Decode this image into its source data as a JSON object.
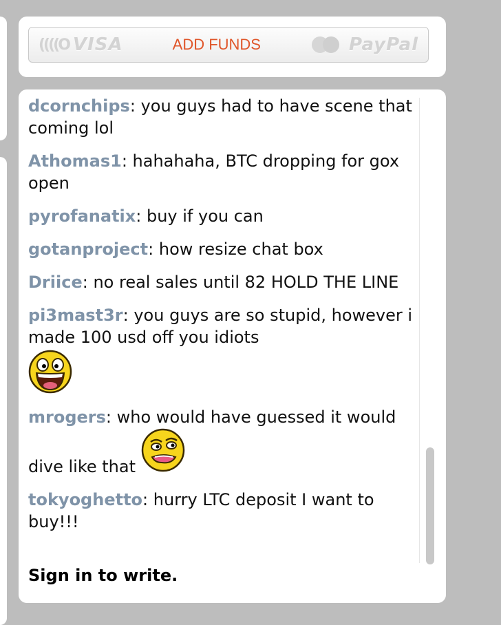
{
  "funds": {
    "contactless_glyph": "((((O",
    "visa": "VISA",
    "add_funds": "ADD FUNDS",
    "paypal": "PayPal"
  },
  "chat": {
    "messages": [
      {
        "user": "dcornchips",
        "text": "you guys had to have scene that coming lol"
      },
      {
        "user": "Athomas1",
        "text": "hahahaha, BTC dropping for gox open"
      },
      {
        "user": "pyrofanatix",
        "text": "buy if you can"
      },
      {
        "user": "gotanproject",
        "text": "how resize chat box"
      },
      {
        "user": "Driice",
        "text": "no real sales until 82 HOLD THE LINE"
      },
      {
        "user": "pi3mast3r",
        "text": "you guys are so stupid, however i made 100 usd off you idiots",
        "emoji": "laughing-face-icon"
      },
      {
        "user": "mrogers",
        "text": "who would have guessed it would dive like that",
        "emoji": "grimace-face-icon"
      },
      {
        "user": "tokyoghetto",
        "text": "hurry LTC deposit I want to buy!!!"
      }
    ],
    "separator": ":",
    "signin": "Sign in to write."
  },
  "colors": {
    "background": "#bdbdbd",
    "username": "#7f93a8",
    "add_funds": "#e0562a"
  }
}
